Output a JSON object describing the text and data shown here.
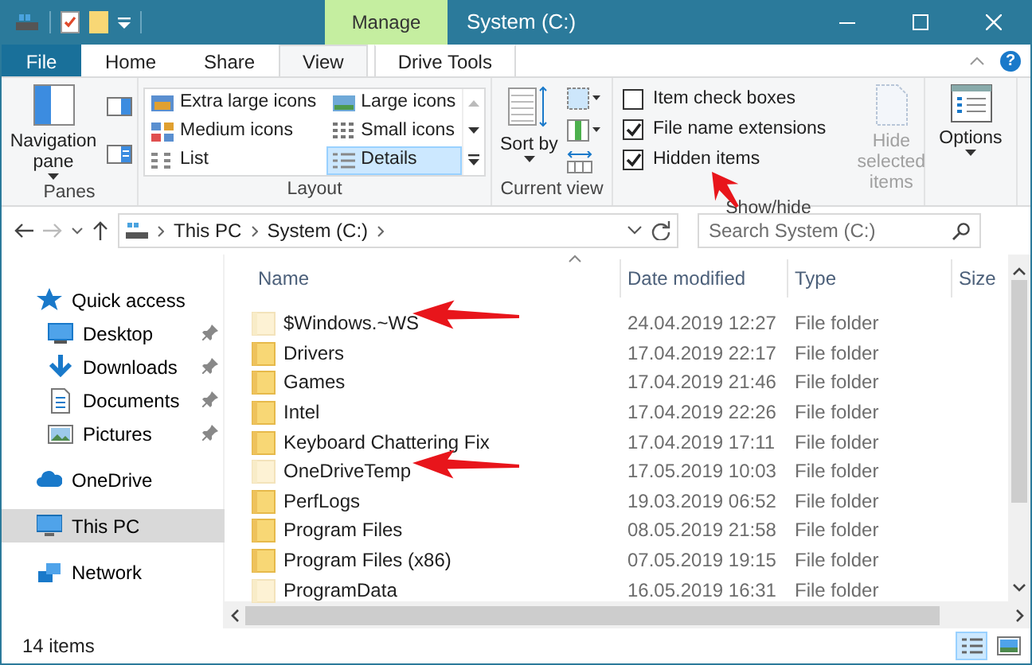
{
  "window": {
    "title": "System (C:)",
    "context_tab": "Manage",
    "help_button": "?"
  },
  "ribbon_tabs": [
    {
      "label": "File",
      "kind": "file",
      "selected": false
    },
    {
      "label": "Home",
      "kind": "tab",
      "selected": false
    },
    {
      "label": "Share",
      "kind": "tab",
      "selected": false
    },
    {
      "label": "View",
      "kind": "tab",
      "selected": true
    },
    {
      "label": "Drive Tools",
      "kind": "tab",
      "selected": false
    }
  ],
  "ribbon": {
    "panes_group": {
      "title": "Panes",
      "navigation_button": "Navigation pane"
    },
    "layout_group": {
      "title": "Layout",
      "options": [
        {
          "label": "Extra large icons",
          "kind": "xl",
          "selected": false
        },
        {
          "label": "Large icons",
          "kind": "large",
          "selected": false
        },
        {
          "label": "Medium icons",
          "kind": "medium",
          "selected": false
        },
        {
          "label": "Small icons",
          "kind": "small",
          "selected": false
        },
        {
          "label": "List",
          "kind": "list",
          "selected": false
        },
        {
          "label": "Details",
          "kind": "details",
          "selected": true
        }
      ]
    },
    "current_view_group": {
      "title": "Current view",
      "sort_button": "Sort by"
    },
    "show_hide_group": {
      "title": "Show/hide",
      "checkboxes": [
        {
          "label": "Item check boxes",
          "checked": false
        },
        {
          "label": "File name extensions",
          "checked": true
        },
        {
          "label": "Hidden items",
          "checked": true
        }
      ],
      "hide_button": {
        "label": "Hide selected items",
        "disabled": true
      }
    },
    "options_button": "Options"
  },
  "address": {
    "breadcrumbs": [
      "This PC",
      "System (C:)"
    ]
  },
  "search": {
    "placeholder": "Search System (C:)"
  },
  "navigation": [
    {
      "label": "Quick access",
      "kind": "star",
      "selected": false,
      "children": [
        {
          "label": "Desktop",
          "kind": "desktop",
          "selected": false,
          "pinned": true
        },
        {
          "label": "Downloads",
          "kind": "download",
          "selected": false,
          "pinned": true
        },
        {
          "label": "Documents",
          "kind": "document",
          "selected": false,
          "pinned": true
        },
        {
          "label": "Pictures",
          "kind": "picture",
          "selected": false,
          "pinned": true
        }
      ]
    },
    {
      "label": "OneDrive",
      "kind": "cloud",
      "selected": false
    },
    {
      "label": "This PC",
      "kind": "pc",
      "selected": true
    },
    {
      "label": "Network",
      "kind": "network",
      "selected": false
    }
  ],
  "file_list": {
    "columns": [
      "Name",
      "Date modified",
      "Type",
      "Size"
    ],
    "rows": [
      {
        "name": "$Windows.~WS",
        "date": "24.04.2019 12:27",
        "type": "File folder",
        "hidden": true
      },
      {
        "name": "Drivers",
        "date": "17.04.2019 22:17",
        "type": "File folder",
        "hidden": false
      },
      {
        "name": "Games",
        "date": "17.04.2019 21:46",
        "type": "File folder",
        "hidden": false
      },
      {
        "name": "Intel",
        "date": "17.04.2019 22:26",
        "type": "File folder",
        "hidden": false
      },
      {
        "name": "Keyboard Chattering Fix",
        "date": "17.04.2019 17:11",
        "type": "File folder",
        "hidden": false
      },
      {
        "name": "OneDriveTemp",
        "date": "17.05.2019 10:03",
        "type": "File folder",
        "hidden": true
      },
      {
        "name": "PerfLogs",
        "date": "19.03.2019 06:52",
        "type": "File folder",
        "hidden": false
      },
      {
        "name": "Program Files",
        "date": "08.05.2019 21:58",
        "type": "File folder",
        "hidden": false
      },
      {
        "name": "Program Files (x86)",
        "date": "07.05.2019 19:15",
        "type": "File folder",
        "hidden": false
      },
      {
        "name": "ProgramData",
        "date": "16.05.2019 16:31",
        "type": "File folder",
        "hidden": true
      }
    ]
  },
  "status_bar": {
    "item_count": "14 items"
  },
  "view_buttons": [
    {
      "kind": "details",
      "selected": true
    },
    {
      "kind": "large",
      "selected": false
    }
  ]
}
